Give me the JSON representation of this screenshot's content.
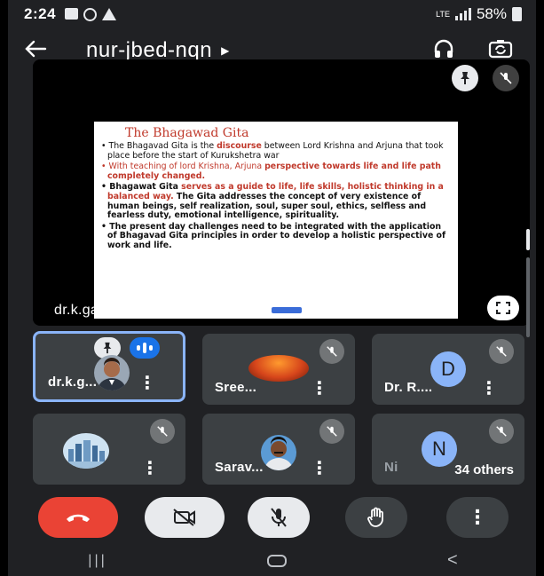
{
  "status_bar": {
    "time": "2:24",
    "network": "LTE",
    "battery": "58%"
  },
  "appbar": {
    "meeting_code": "nur-jbed-nqn",
    "back_icon": "arrow-left-icon",
    "audio_icon": "headphones-icon",
    "switch_camera_icon": "switch-camera-icon"
  },
  "presentation": {
    "presenter_text": "dr.k.gangadharan is presenting",
    "slide": {
      "title": "The Bhagawad Gita",
      "bullet1_a": "The Bhagavad Gita is the ",
      "bullet1_b": "discourse",
      "bullet1_c": " between Lord Krishna and Arjuna that took place before the start of Kurukshetra war",
      "bullet2_a": "With teaching of lord Krishna, Arjuna ",
      "bullet2_b": "perspective towards life and life path completely changed.",
      "bullet3_a": "Bhagawat Gita ",
      "bullet3_b": "serves as a guide to life, life skills, holistic thinking in a balanced way.",
      "bullet3_c": " The Gita addresses the concept of very existence of human beings, self realization, soul, super soul, ethics, selfless and fearless duty, emotional intelligence, spirituality.",
      "bullet4": "The present day challenges need to be integrated with the application of Bhagavad Gita principles in order to develop a holistic perspective of work and life."
    }
  },
  "participants": [
    {
      "name": "dr.k.g...",
      "avatar": "photo-man",
      "pinned": true,
      "speaking": true
    },
    {
      "name": "Sree...",
      "avatar": "sunset",
      "muted": true
    },
    {
      "name": "Dr. R....",
      "avatar_letter": "D",
      "muted": true
    },
    {
      "name": "",
      "avatar": "skyline",
      "muted": true
    },
    {
      "name": "Sarav...",
      "avatar": "photo-man-2",
      "muted": true
    },
    {
      "name_prefix": "Ni",
      "avatar_letter": "N",
      "others": "34 others",
      "muted": true
    }
  ],
  "controls": {
    "hangup": "end-call-icon",
    "camera": "video-off-icon",
    "mic": "mic-off-icon",
    "hand": "raise-hand-icon",
    "more": "⋮"
  },
  "colors": {
    "background": "#202124",
    "tile": "#3c4043",
    "hangup": "#ea4335",
    "active_border": "#8ab4f8",
    "slide_red": "#c0392b"
  }
}
